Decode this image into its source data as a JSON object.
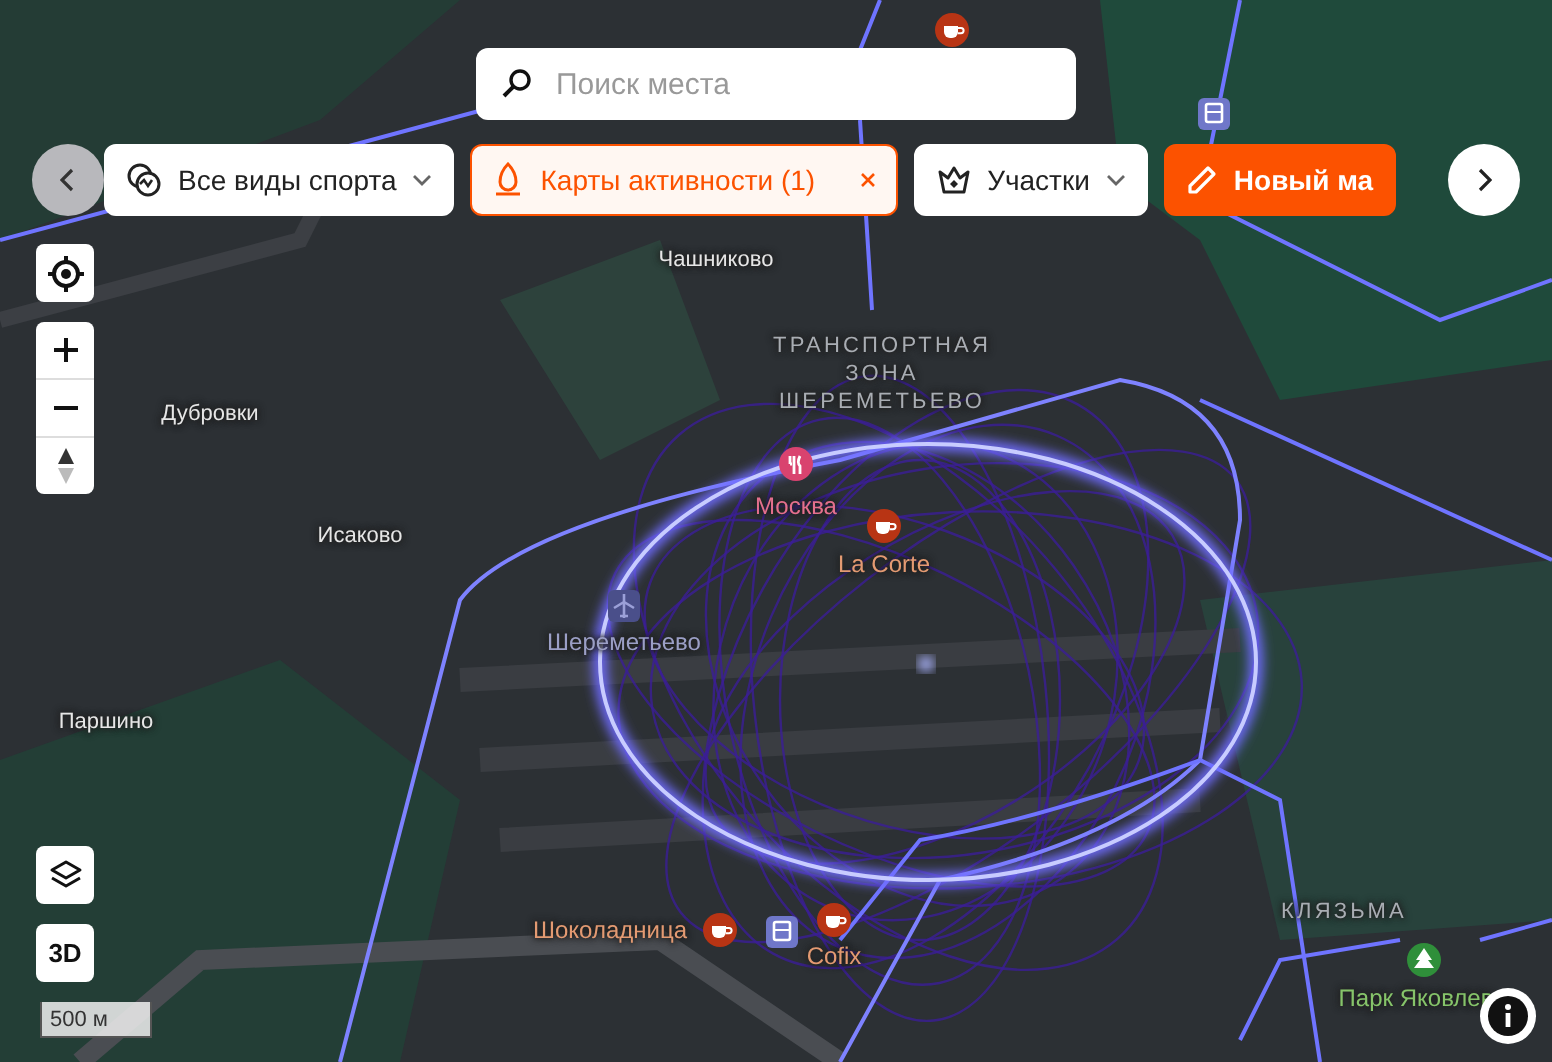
{
  "search": {
    "placeholder": "Поиск места"
  },
  "filters": [
    {
      "label": "Все виды спорта",
      "kind": "dropdown",
      "selected": false
    },
    {
      "label": "Карты активности (1)",
      "kind": "removable",
      "selected": true
    },
    {
      "label": "Участки",
      "kind": "dropdown",
      "selected": false
    },
    {
      "label": "Новый ма",
      "kind": "action",
      "selected": false
    }
  ],
  "map_labels": [
    {
      "text": "Чашниково",
      "kind": "place"
    },
    {
      "text": "ТРАНСПОРТНАЯ\nЗОНА\nШЕРЕМЕТЬЕВО",
      "kind": "district"
    },
    {
      "text": "Дубровки",
      "kind": "place"
    },
    {
      "text": "Исаково",
      "kind": "place"
    },
    {
      "text": "Москва",
      "kind": "restaurant"
    },
    {
      "text": "La Corte",
      "kind": "cafe"
    },
    {
      "text": "Шереметьево",
      "kind": "airport"
    },
    {
      "text": "Паршино",
      "kind": "place"
    },
    {
      "text": "Шоколадница",
      "kind": "cafe"
    },
    {
      "text": "Cofix",
      "kind": "cafe"
    },
    {
      "text": "КЛЯЗЬМА",
      "kind": "district"
    },
    {
      "text": "Парк Яковлев",
      "kind": "park"
    }
  ],
  "view_button": {
    "label": "3D"
  },
  "scale": {
    "label": "500 м"
  }
}
